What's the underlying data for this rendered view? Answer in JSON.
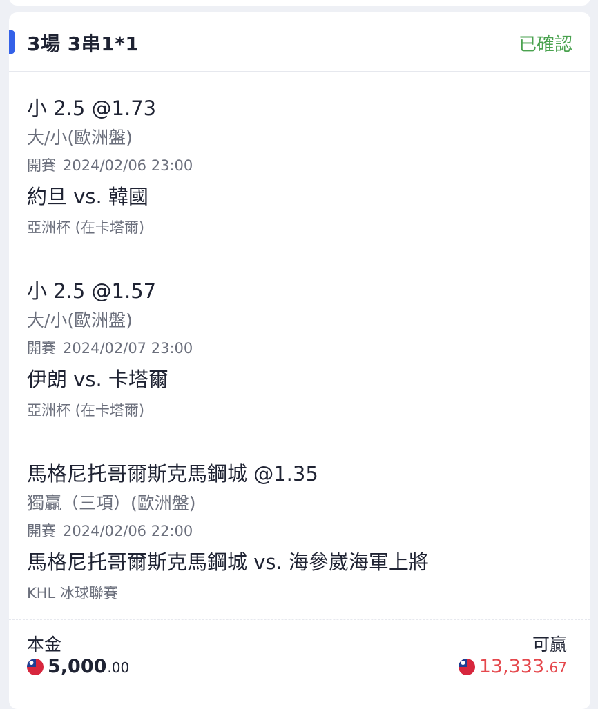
{
  "header": {
    "title": "3場 3串1*1",
    "status": "已確認"
  },
  "colors": {
    "accent": "#3461e8",
    "status_confirmed": "#4aa24f",
    "payout": "#e5484d"
  },
  "bets": [
    {
      "selection": "小 2.5 @1.73",
      "market": "大/小(歐洲盤)",
      "start_label": "開賽",
      "start_time": "2024/02/06 23:00",
      "matchup": "約旦 vs. 韓國",
      "league": "亞洲杯 (在卡塔爾)"
    },
    {
      "selection": "小 2.5 @1.57",
      "market": "大/小(歐洲盤)",
      "start_label": "開賽",
      "start_time": "2024/02/07 23:00",
      "matchup": "伊朗 vs. 卡塔爾",
      "league": "亞洲杯 (在卡塔爾)"
    },
    {
      "selection": "馬格尼托哥爾斯克馬鋼城 @1.35",
      "market": "獨贏（三項）(歐洲盤)",
      "start_label": "開賽",
      "start_time": "2024/02/06 22:00",
      "matchup": "馬格尼托哥爾斯克馬鋼城 vs. 海參崴海軍上將",
      "league": "KHL 冰球聯賽"
    }
  ],
  "summary": {
    "stake_label": "本金",
    "stake_main": "5,000",
    "stake_decimal": ".00",
    "payout_label": "可贏",
    "payout_main": "13,333",
    "payout_decimal": ".67",
    "currency_icon": "taiwan-flag-icon"
  }
}
